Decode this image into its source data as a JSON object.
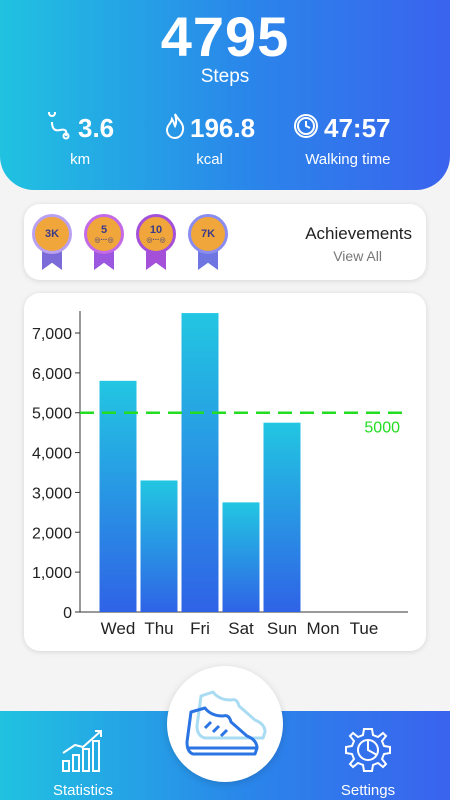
{
  "header": {
    "steps_value": "4795",
    "steps_label": "Steps",
    "distance": {
      "value": "3.6",
      "unit": "km",
      "icon": "route-icon"
    },
    "calories": {
      "value": "196.8",
      "unit": "kcal",
      "icon": "flame-icon"
    },
    "time": {
      "value": "47:57",
      "unit": "Walking time",
      "icon": "timer-icon"
    }
  },
  "achievements": {
    "title": "Achievements",
    "link": "View All",
    "medals": [
      {
        "label": "3K",
        "sub": "",
        "color": "#f0a63b",
        "ribbon": "#7b6bd8"
      },
      {
        "label": "5",
        "sub": "◎···◎",
        "color": "#c46ae6",
        "ribbon": "#9b57e0"
      },
      {
        "label": "10",
        "sub": "◎···◎",
        "color": "#f0a63b",
        "ribbon": "#a450d8"
      },
      {
        "label": "7K",
        "sub": "",
        "color": "#f0a63b",
        "ribbon": "#6f76e2"
      }
    ]
  },
  "chart_data": {
    "type": "bar",
    "categories": [
      "Wed",
      "Thu",
      "Fri",
      "Sat",
      "Sun",
      "Mon",
      "Tue"
    ],
    "values": [
      5800,
      3300,
      7500,
      2750,
      4750,
      0,
      0
    ],
    "ylim": [
      0,
      7000
    ],
    "yticks": [
      "0",
      "1,000",
      "2,000",
      "3,000",
      "4,000",
      "5,000",
      "6,000",
      "7,000"
    ],
    "goal": {
      "value": 5000,
      "label": "5000",
      "color": "#22dd22"
    },
    "bar_color_top": "#22c6e2",
    "bar_color_bottom": "#2f63e6",
    "grid": false
  },
  "nav": {
    "statistics": "Statistics",
    "settings": "Settings"
  }
}
